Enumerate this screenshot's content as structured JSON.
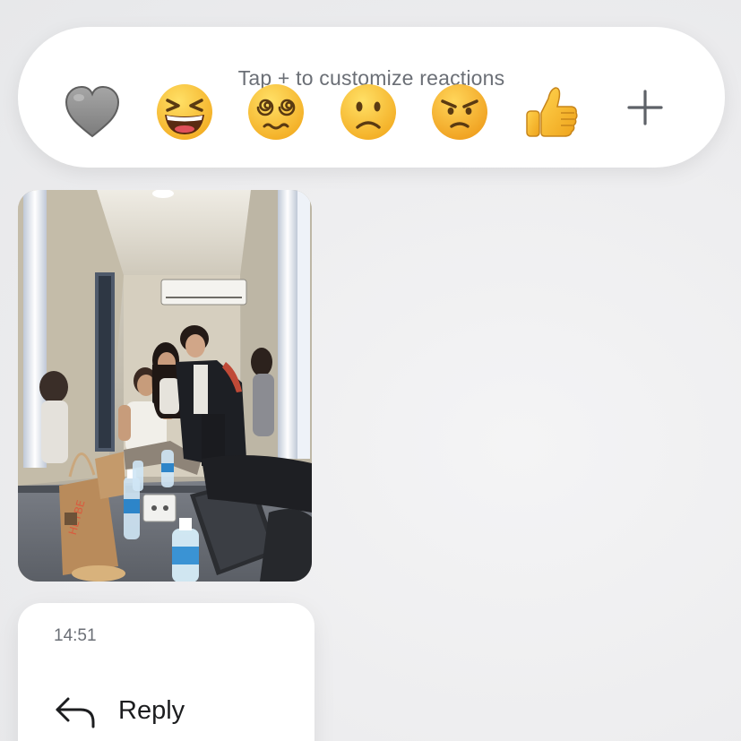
{
  "reactions": {
    "hint": "Tap + to customize reactions",
    "items": [
      {
        "name": "grey-heart",
        "emoji": "🩶"
      },
      {
        "name": "laughing",
        "emoji": "😆"
      },
      {
        "name": "dizzy-face",
        "emoji": "😵‍💫"
      },
      {
        "name": "slightly-frowning",
        "emoji": "🙁"
      },
      {
        "name": "angry",
        "emoji": "😠"
      },
      {
        "name": "thumbs-up",
        "emoji": "👍"
      }
    ],
    "add_icon": "plus-icon"
  },
  "message": {
    "photo_alt": "mirror selfie photo",
    "bag_text": "HEYBE"
  },
  "context_menu": {
    "time": "14:51",
    "items": [
      {
        "label": "Reply",
        "icon": "reply-arrow-icon"
      }
    ]
  },
  "colors": {
    "background": "#eeeff1",
    "card": "#ffffff",
    "muted_text": "#6b6f76",
    "primary_text": "#1c1d1f",
    "emoji_yellow": "#f7c02a",
    "heart_grey": "#8e8e8e"
  }
}
